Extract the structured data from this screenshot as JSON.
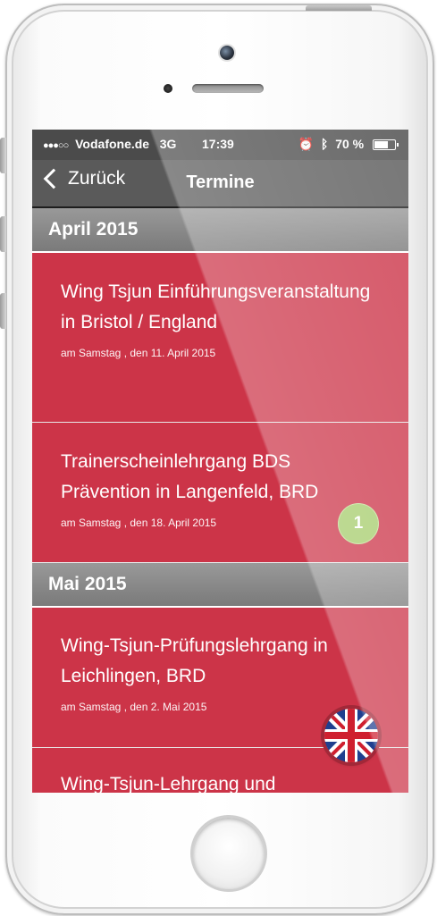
{
  "status_bar": {
    "carrier": "Vodafone.de",
    "network": "3G",
    "time": "17:39",
    "battery": "70 %",
    "battery_level": 0.7
  },
  "nav": {
    "back_label": "Zurück",
    "title": "Termine"
  },
  "sections": [
    {
      "header": "April 2015",
      "items": [
        {
          "title": "Wing Tsjun Einführungsveranstaltung in Bristol / England",
          "date": "am Samstag , den 11. April 2015"
        },
        {
          "title": "Trainerscheinlehrgang BDS Prävention in Langenfeld, BRD",
          "date": "am Samstag , den 18. April 2015",
          "badge": "1"
        }
      ]
    },
    {
      "header": "Mai 2015",
      "items": [
        {
          "title": "Wing-Tsjun-Prüfungslehrgang in Leichlingen, BRD",
          "date": "am Samstag , den 2. Mai 2015"
        },
        {
          "title": "Wing-Tsjun-Lehrgang und"
        }
      ]
    }
  ],
  "colors": {
    "item_bg": "#cc3448",
    "badge": "#a5cc6b",
    "header_bg": "#8a8a8a"
  },
  "icons": {
    "language": "uk-flag-icon",
    "back": "chevron-left-icon"
  }
}
